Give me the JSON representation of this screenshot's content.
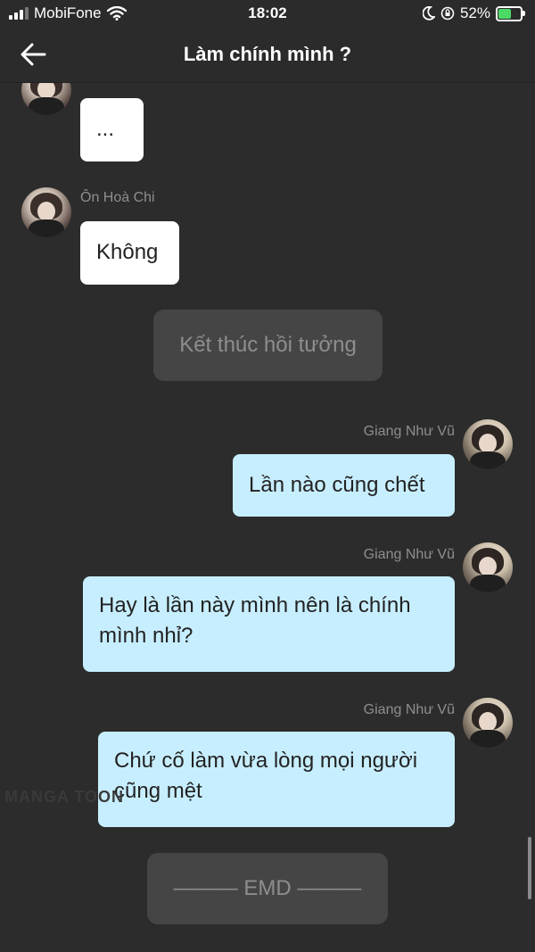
{
  "status_bar": {
    "carrier": "MobiFone",
    "time": "18:02",
    "battery": "52%",
    "battery_level": 0.52,
    "icons": [
      "signal-icon",
      "wifi-icon",
      "moon-icon",
      "orientation-lock-icon",
      "battery-charging-icon"
    ]
  },
  "header": {
    "title": "Làm chính mình ?",
    "back_icon": "back-arrow-icon"
  },
  "messages": [
    {
      "side": "left",
      "sender": "",
      "text": "..."
    },
    {
      "side": "left",
      "sender": "Ôn Hoà Chi",
      "text": "Không"
    },
    {
      "type": "system",
      "text": "Kết thúc hồi tưởng"
    },
    {
      "side": "right",
      "sender": "Giang Như Vũ",
      "text": "Lần nào cũng chết"
    },
    {
      "side": "right",
      "sender": "Giang Như Vũ",
      "text": "Hay là lần này mình nên là chính mình nhỉ?"
    },
    {
      "side": "right",
      "sender": "Giang Như Vũ",
      "text": "Chứ cố làm vừa lòng mọi người cũng mệt"
    },
    {
      "type": "system",
      "text": "——— EMD ———"
    }
  ],
  "watermark": "MANGA TOON",
  "colors": {
    "background": "#2c2c2c",
    "left_bubble": "#ffffff",
    "right_bubble": "#c7eefe",
    "system_bubble": "#454545",
    "name_text": "#8e8e8e"
  }
}
